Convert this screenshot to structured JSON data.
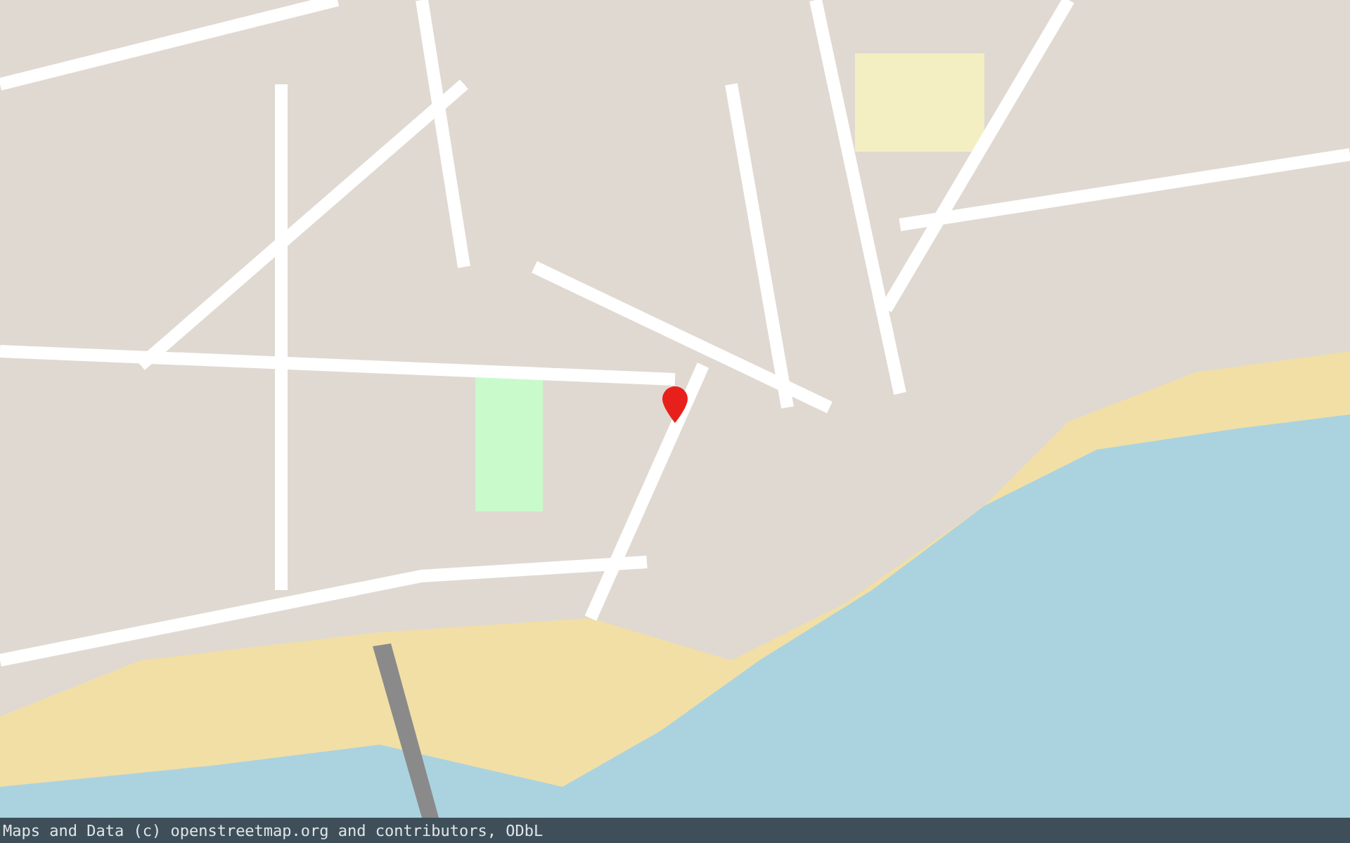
{
  "attribution": {
    "text": "Maps and Data (c) openstreetmap.org and contributors, ODbL"
  }
}
